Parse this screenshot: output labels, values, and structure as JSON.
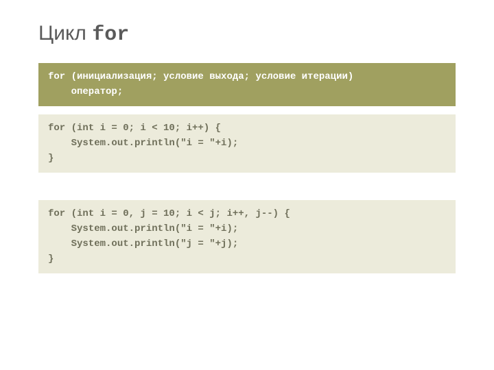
{
  "title": {
    "word": "Цикл ",
    "keyword": "for"
  },
  "boxes": {
    "syntax": "for (инициализация; условие выхода; условие итерации)\n    оператор;",
    "example1": "for (int i = 0; i < 10; i++) {\n    System.out.println(\"i = \"+i);\n}",
    "example2": "for (int i = 0, j = 10; i < j; i++, j--) {\n    System.out.println(\"i = \"+i);\n    System.out.println(\"j = \"+j);\n}"
  }
}
